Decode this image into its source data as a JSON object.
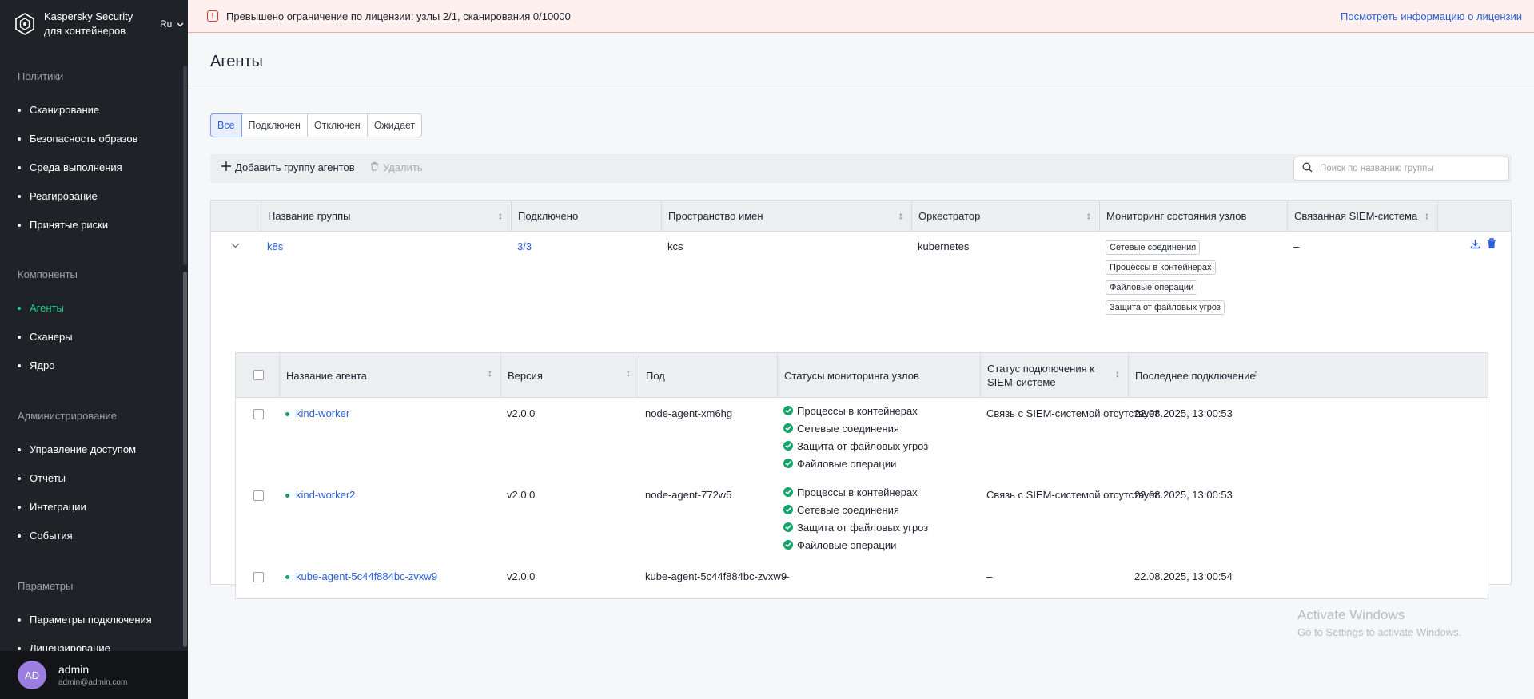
{
  "sidebar": {
    "brand": "Kaspersky Security для контейнеров",
    "brand_line1": "Kaspersky Security",
    "brand_line2": "для контейнеров",
    "lang": "Ru",
    "sections": [
      {
        "title": "Политики",
        "items": [
          "Сканирование",
          "Безопасность образов",
          "Среда выполнения",
          "Реагирование",
          "Принятые риски"
        ]
      },
      {
        "title": "Компоненты",
        "items": [
          "Агенты",
          "Сканеры",
          "Ядро"
        ]
      },
      {
        "title": "Администрирование",
        "items": [
          "Управление доступом",
          "Отчеты",
          "Интеграции",
          "События"
        ]
      },
      {
        "title": "Параметры",
        "items": [
          "Параметры подключения",
          "Лицензирование"
        ]
      }
    ],
    "active_item": "Агенты",
    "user": {
      "initials": "AD",
      "name": "admin",
      "email": "admin@admin.com"
    }
  },
  "banner": {
    "text": "Превышено ограничение по лицензии: узлы 2/1, сканирования 0/10000",
    "link": "Посмотреть информацию о лицензии"
  },
  "page": {
    "title": "Агенты"
  },
  "filters": {
    "items": [
      "Все",
      "Подключен",
      "Отключен",
      "Ожидает"
    ],
    "active": "Все"
  },
  "toolbar": {
    "add_label": "Добавить группу агентов",
    "delete_label": "Удалить",
    "search_placeholder": "Поиск по названию группы"
  },
  "groups_table": {
    "columns": [
      "Название группы",
      "Подключено",
      "Пространство имен",
      "Оркестратор",
      "Мониторинг состояния узлов",
      "Связанная SIEM-система"
    ],
    "rows": [
      {
        "name": "k8s",
        "connected": "3/3",
        "namespace": "kcs",
        "orchestrator": "kubernetes",
        "monitoring": [
          "Сетевые соединения",
          "Процессы в контейнерах",
          "Файловые операции",
          "Защита от файловых угроз"
        ],
        "siem": "–"
      }
    ]
  },
  "agents_table": {
    "columns": [
      "Название агента",
      "Версия",
      "Под",
      "Статусы мониторинга узлов",
      "Статус подключения к SIEM-системе",
      "Последнее подключение"
    ],
    "rows": [
      {
        "name": "kind-worker",
        "version": "v2.0.0",
        "pod": "node-agent-xm6hg",
        "statuses": [
          "Процессы в контейнерах",
          "Сетевые соединения",
          "Защита от файловых угроз",
          "Файловые операции"
        ],
        "siem": "Связь с SIEM-системой отсутствует",
        "last": "22.08.2025, 13:00:53"
      },
      {
        "name": "kind-worker2",
        "version": "v2.0.0",
        "pod": "node-agent-772w5",
        "statuses": [
          "Процессы в контейнерах",
          "Сетевые соединения",
          "Защита от файловых угроз",
          "Файловые операции"
        ],
        "siem": "Связь с SIEM-системой отсутствует",
        "last": "22.08.2025, 13:00:53"
      },
      {
        "name": "kube-agent-5c44f884bc-zvxw9",
        "version": "v2.0.0",
        "pod": "kube-agent-5c44f884bc-zvxw9",
        "statuses_text": "–",
        "siem": "–",
        "last": "22.08.2025, 13:00:54"
      }
    ]
  },
  "watermark": {
    "line1": "Activate Windows",
    "line2": "Go to Settings to activate Windows."
  },
  "colors": {
    "sidebar_bg": "#1f2227",
    "accent": "#2b5fd9",
    "active_nav": "#1fcf8f",
    "success": "#14a36b",
    "banner_bg": "#fdf0ef",
    "error": "#d9362b"
  }
}
